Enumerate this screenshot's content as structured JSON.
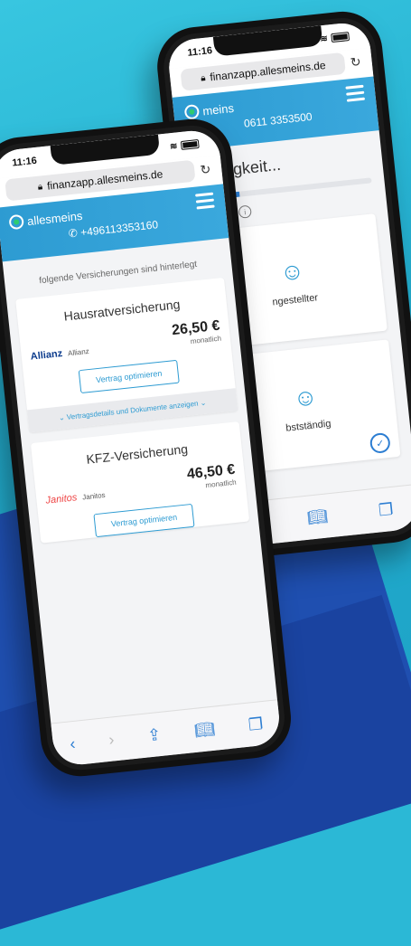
{
  "back_phone": {
    "status_time": "11:16",
    "url": "finanzapp.allesmeins.de",
    "logo_text": "meins",
    "phone": "0611 3353500",
    "page_title": "e Tätigkeit...",
    "progress": 0.25,
    "choices": [
      {
        "label": "ngestellter"
      },
      {
        "label": "bstständig"
      }
    ]
  },
  "front_phone": {
    "status_time": "11:16",
    "url": "finanzapp.allesmeins.de",
    "logo_text": "allesmeins",
    "phone": "+496113353160",
    "intro": "folgende Versicherungen sind hinterlegt",
    "cards": [
      {
        "title": "Hausratversicherung",
        "insurer_logo": "Allianz",
        "insurer": "Allianz",
        "amount": "26,50 €",
        "period": "monatlich",
        "button": "Vertrag optimieren",
        "details": "Vertragsdetails und Dokumente anzeigen"
      },
      {
        "title": "KFZ-Versicherung",
        "insurer_logo": "Janitos",
        "insurer": "Janitos",
        "amount": "46,50 €",
        "period": "monatlich",
        "button": "Vertrag optimieren"
      }
    ]
  }
}
